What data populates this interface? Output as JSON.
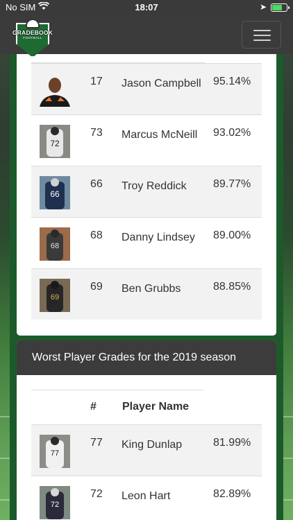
{
  "status_bar": {
    "carrier": "No SIM",
    "time": "18:07",
    "battery_level": 0.75,
    "icons": [
      "wifi-icon",
      "location-arrow-icon",
      "battery-charging-icon"
    ]
  },
  "navbar": {
    "logo_text": "GRADEBOOK",
    "logo_subtext": "FOOTBALL",
    "menu_icon": "hamburger-menu-icon"
  },
  "best_players": {
    "rows": [
      {
        "number": "17",
        "name": "Jason Campbell",
        "grade": "95.14%"
      },
      {
        "number": "73",
        "name": "Marcus McNeill",
        "grade": "93.02%"
      },
      {
        "number": "66",
        "name": "Troy Reddick",
        "grade": "89.77%"
      },
      {
        "number": "68",
        "name": "Danny Lindsey",
        "grade": "89.00%"
      },
      {
        "number": "69",
        "name": "Ben Grubbs",
        "grade": "88.85%"
      }
    ]
  },
  "worst_players": {
    "title": "Worst Player Grades for the 2019 season",
    "col_number": "#",
    "col_name": "Player Name",
    "rows": [
      {
        "number": "77",
        "name": "King Dunlap",
        "grade": "81.99%"
      },
      {
        "number": "72",
        "name": "Leon Hart",
        "grade": "82.89%"
      }
    ]
  },
  "colors": {
    "nav_bg": "#3b3b3b",
    "frame_green": "#1c5a2b",
    "row_stripe": "#f2f2f2"
  }
}
